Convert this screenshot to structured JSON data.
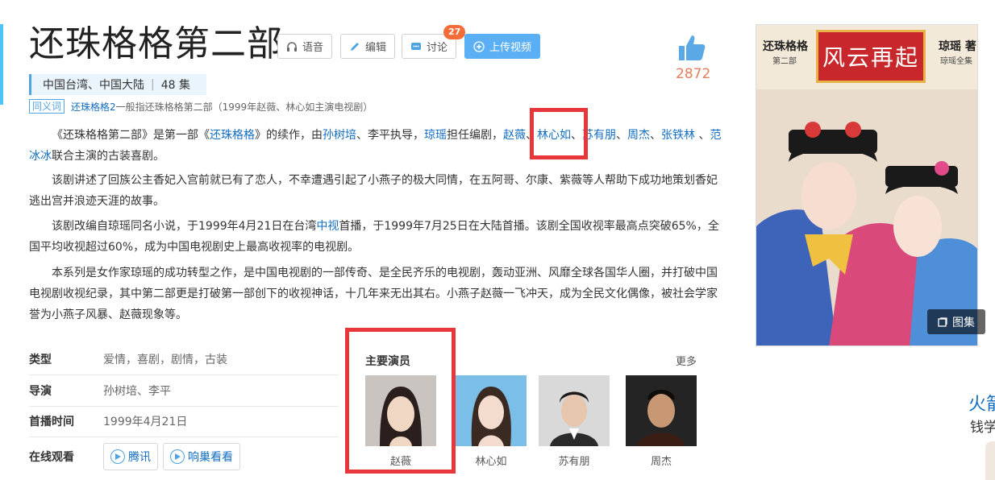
{
  "title": "还珠格格第二部",
  "toolbar": {
    "voice": "语音",
    "edit": "编辑",
    "discuss": "讨论",
    "discuss_count": "27",
    "upload": "上传视频"
  },
  "like_count": "2872",
  "meta": {
    "region": "中国台湾、中国大陆",
    "episodes": "48 集"
  },
  "synonym": {
    "tag": "同义词",
    "link": "还珠格格2",
    "desc": "一般指还珠格格第二部（1999年赵薇、林心如主演电视剧）"
  },
  "intro": {
    "p1": {
      "t1": "《还珠格格第二部》是第一部《",
      "l1": "还珠格格",
      "t2": "》的续作，由",
      "l2": "孙树培",
      "t3": "、李平执导，",
      "l3": "琼瑶",
      "t4": "担任编剧，",
      "l4": "赵薇",
      "t5": "、",
      "l5": "林心如",
      "t6": "、",
      "l6": "苏有朋",
      "t7": "、",
      "l7": "周杰",
      "t8": "、",
      "l8": "张铁林",
      "t9": " 、",
      "l9": "范冰冰",
      "t10": "联合主演的古装喜剧。"
    },
    "p2": "该剧讲述了回族公主香妃入宫前就已有了恋人，不幸遭遇引起了小燕子的极大同情，在五阿哥、尔康、紫薇等人帮助下成功地策划香妃逃出宫并浪迹天涯的故事。",
    "p3": {
      "t1": "该剧改编自琼瑶同名小说，于1999年4月21日在台湾",
      "l1": "中视",
      "t2": "首播，于1999年7月25日在大陆首播。该剧全国收视率最高点突破65%，全国平均收视超过60%，成为中国电视剧史上最高收视率的电视剧。"
    },
    "p4": "本系列是女作家琼瑶的成功转型之作，是中国电视剧的一部传奇、是全民齐乐的电视剧，轰动亚洲、风靡全球各国华人圈，并打破中国电视剧收视纪录，其中第二部更是打破第一部创下的收视神话，十几年来无出其右。小燕子赵薇一飞冲天，成为全民文化偶像，被社会学家誉为小燕子风暴、赵薇现象等。"
  },
  "info": {
    "genre_label": "类型",
    "genre": "爱情，喜剧，剧情，古装",
    "director_label": "导演",
    "director": "孙树培、李平",
    "premiere_label": "首播时间",
    "premiere": "1999年4月21日",
    "watch_label": "在线观看",
    "watch1": "腾讯",
    "watch2": "响巢看看"
  },
  "cast": {
    "title": "主要演员",
    "more": "更多",
    "actors": [
      "赵薇",
      "林心如",
      "苏有朋",
      "周杰"
    ]
  },
  "poster": {
    "left_title": "还珠格格",
    "left_sub": "第二部",
    "sign": "风云再起",
    "right_title": "琼瑶 著",
    "right_sub": "琼瑶全集",
    "gallery": "图集"
  },
  "side": {
    "line1": "火箭",
    "line2": "钱学"
  }
}
